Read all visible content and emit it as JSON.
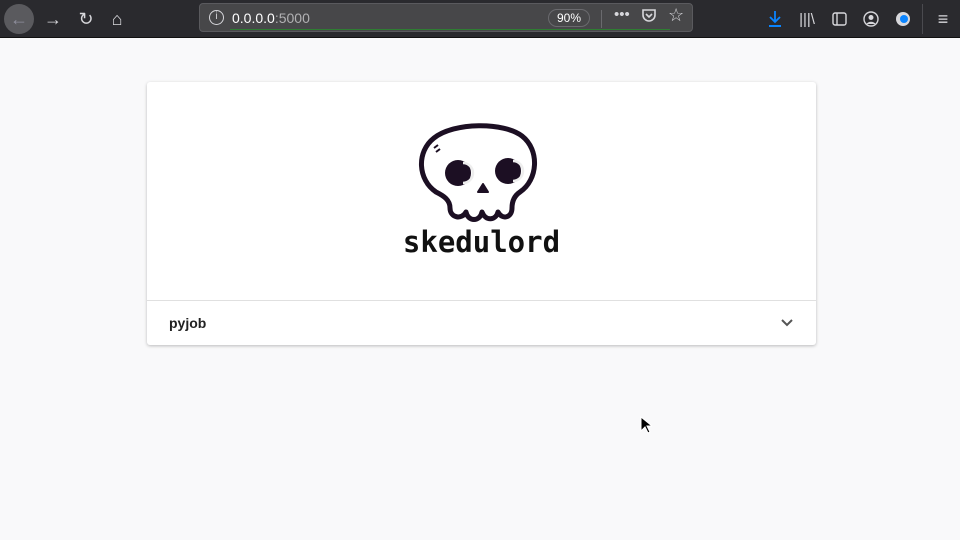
{
  "browser": {
    "url_host": "0.0.0.0",
    "url_port": ":5000",
    "zoom": "90%",
    "icons": [
      "back-icon",
      "forward-icon",
      "reload-icon",
      "home-icon",
      "info-icon",
      "more-icon",
      "pocket-icon",
      "star-icon",
      "download-icon",
      "library-icon",
      "sidebar-icon",
      "account-icon",
      "extension-icon",
      "menu-icon"
    ],
    "accent": "#0a84ff"
  },
  "app": {
    "brand": "skedulord",
    "jobs": [
      {
        "name": "pyjob"
      }
    ]
  }
}
